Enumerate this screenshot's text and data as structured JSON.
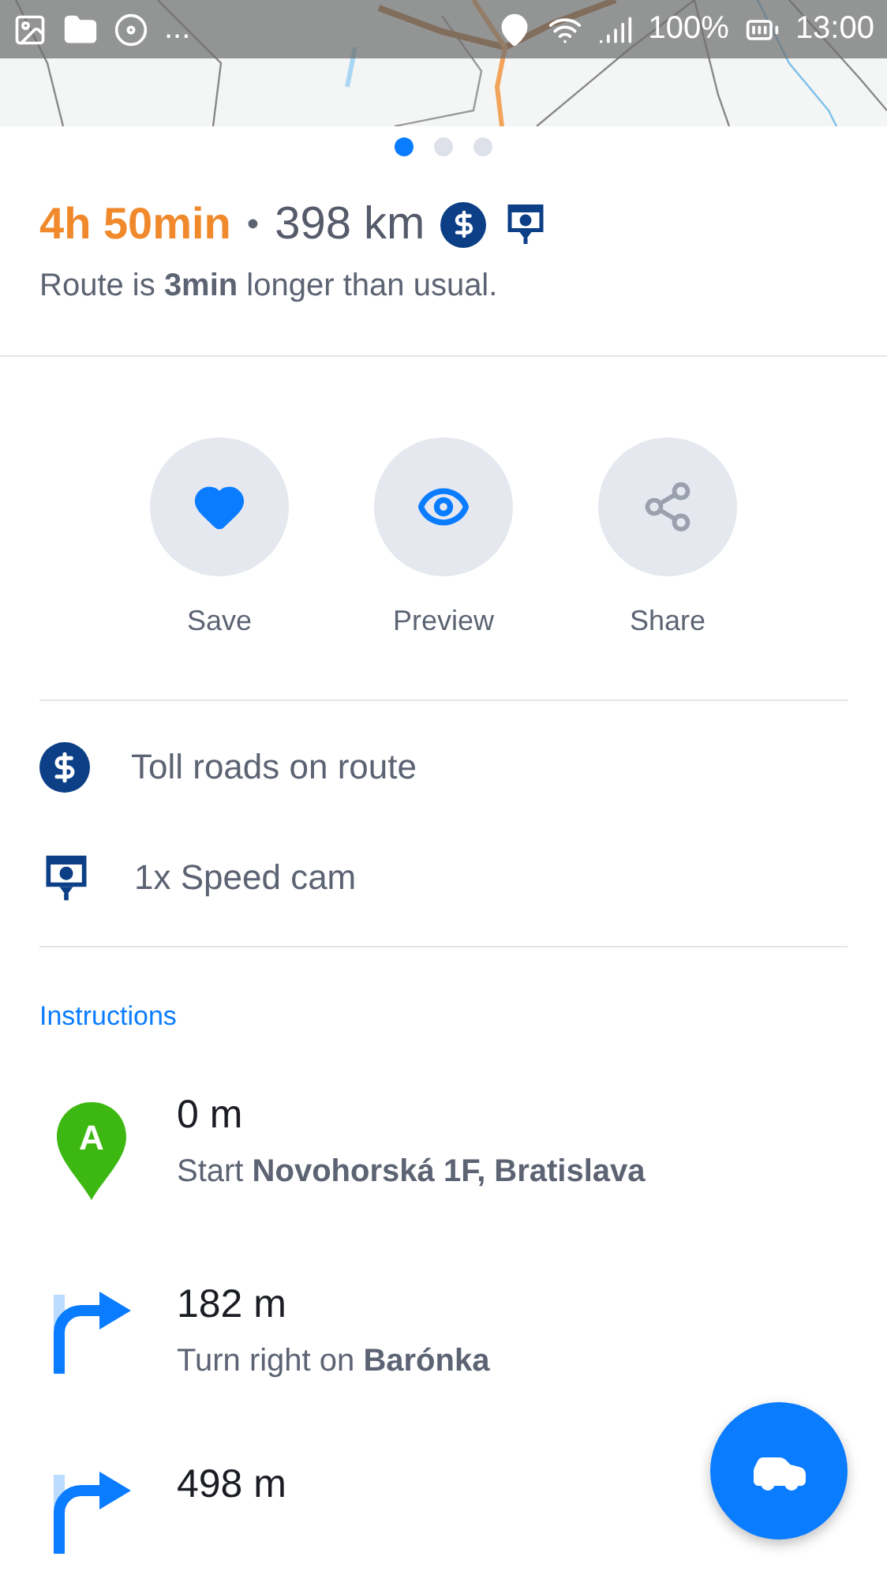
{
  "status_bar": {
    "more": "...",
    "battery": "100%",
    "time": "13:00"
  },
  "pager": [
    {
      "selected": true
    },
    {
      "selected": false
    },
    {
      "selected": false
    }
  ],
  "summary": {
    "duration": "4h 50min",
    "separator": "•",
    "distance": "398 km",
    "note": "Route is **3min** longer than usual."
  },
  "actions": [
    {
      "kind": "save",
      "label": "Save"
    },
    {
      "kind": "preview",
      "label": "Preview"
    },
    {
      "kind": "share",
      "label": "Share"
    }
  ],
  "features": [
    {
      "kind": "toll",
      "label": "Toll roads on route"
    },
    {
      "kind": "speed_cam",
      "label": "1x Speed cam"
    }
  ],
  "instructions": {
    "title": "Instructions",
    "steps": [
      {
        "kind": "start",
        "marker": "A",
        "distance": "0 m",
        "text": "Start **Novohorská 1F, Bratislava**"
      },
      {
        "kind": "turn_right",
        "distance": "182 m",
        "text": "Turn right on **Barónka**"
      },
      {
        "kind": "turn_right",
        "distance": "498 m"
      }
    ]
  }
}
